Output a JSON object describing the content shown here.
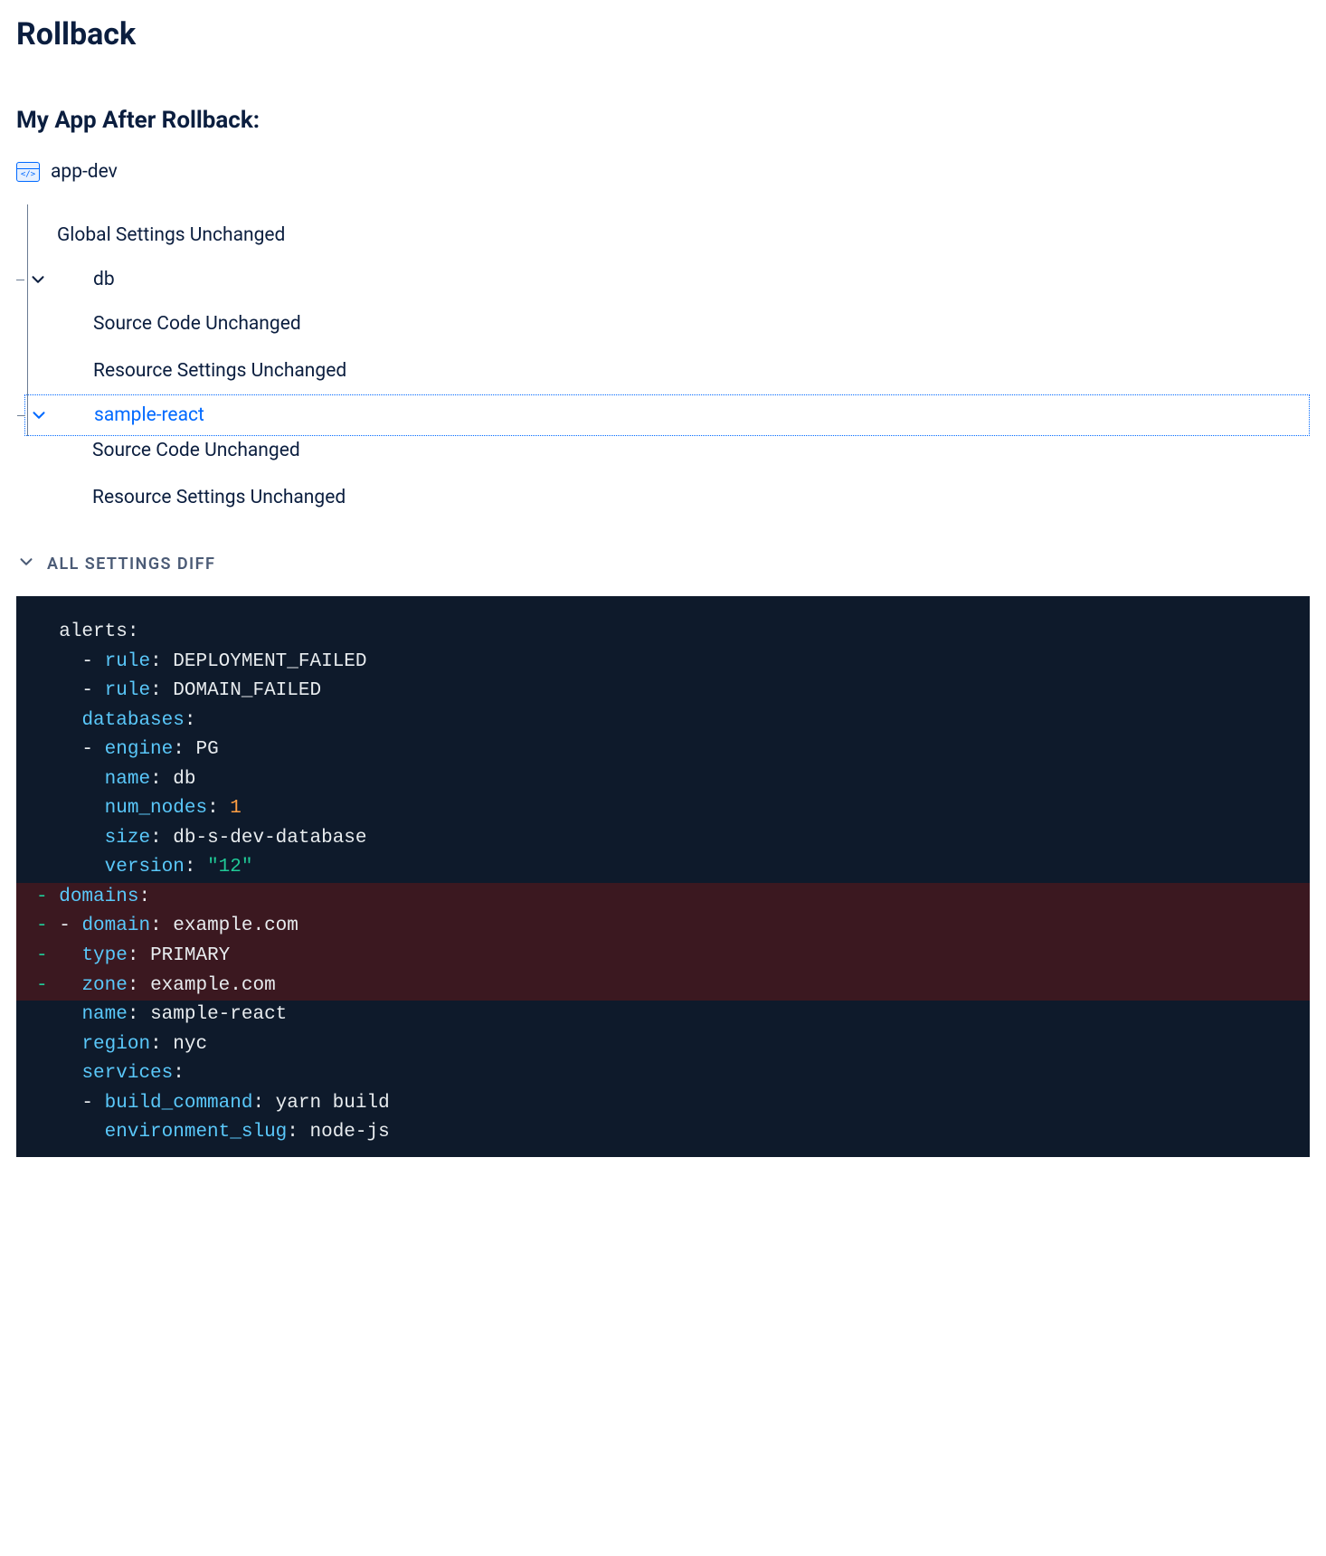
{
  "title": "Rollback",
  "subhead": "My App After Rollback:",
  "app": {
    "name": "app-dev"
  },
  "tree": {
    "global_unchanged": "Global Settings Unchanged",
    "nodes": [
      {
        "id": "db",
        "label": "db",
        "selected": false,
        "rows": [
          "Source Code Unchanged",
          "Resource Settings Unchanged"
        ]
      },
      {
        "id": "sample-react",
        "label": "sample-react",
        "selected": true,
        "rows": [
          "Source Code Unchanged",
          "Resource Settings Unchanged"
        ]
      }
    ]
  },
  "diff_section": {
    "label": "ALL SETTINGS DIFF"
  },
  "diff": [
    {
      "removed": false,
      "mark": "  ",
      "segs": [
        [
          "plain",
          "alerts:"
        ]
      ]
    },
    {
      "removed": false,
      "mark": "  ",
      "segs": [
        [
          "plain",
          "  - "
        ],
        [
          "kw",
          "rule"
        ],
        [
          "plain",
          ": DEPLOYMENT_FAILED"
        ]
      ]
    },
    {
      "removed": false,
      "mark": "  ",
      "segs": [
        [
          "plain",
          "  - "
        ],
        [
          "kw",
          "rule"
        ],
        [
          "plain",
          ": DOMAIN_FAILED"
        ]
      ]
    },
    {
      "removed": false,
      "mark": "  ",
      "segs": [
        [
          "plain",
          "  "
        ],
        [
          "kw",
          "databases"
        ],
        [
          "plain",
          ":"
        ]
      ]
    },
    {
      "removed": false,
      "mark": "  ",
      "segs": [
        [
          "plain",
          "  - "
        ],
        [
          "kw",
          "engine"
        ],
        [
          "plain",
          ": PG"
        ]
      ]
    },
    {
      "removed": false,
      "mark": "  ",
      "segs": [
        [
          "plain",
          "    "
        ],
        [
          "kw",
          "name"
        ],
        [
          "plain",
          ": db"
        ]
      ]
    },
    {
      "removed": false,
      "mark": "  ",
      "segs": [
        [
          "plain",
          "    "
        ],
        [
          "kw",
          "num_nodes"
        ],
        [
          "plain",
          ": "
        ],
        [
          "num",
          "1"
        ]
      ]
    },
    {
      "removed": false,
      "mark": "  ",
      "segs": [
        [
          "plain",
          "    "
        ],
        [
          "kw",
          "size"
        ],
        [
          "plain",
          ": db-s-dev-database"
        ]
      ]
    },
    {
      "removed": false,
      "mark": "  ",
      "segs": [
        [
          "plain",
          "    "
        ],
        [
          "kw",
          "version"
        ],
        [
          "plain",
          ": "
        ],
        [
          "str",
          "\"12\""
        ]
      ]
    },
    {
      "removed": true,
      "mark": "- ",
      "segs": [
        [
          "kw",
          "domains"
        ],
        [
          "plain",
          ":"
        ]
      ]
    },
    {
      "removed": true,
      "mark": "- ",
      "segs": [
        [
          "plain",
          "- "
        ],
        [
          "kw",
          "domain"
        ],
        [
          "plain",
          ": example.com"
        ]
      ]
    },
    {
      "removed": true,
      "mark": "- ",
      "segs": [
        [
          "plain",
          "  "
        ],
        [
          "kw",
          "type"
        ],
        [
          "plain",
          ": PRIMARY"
        ]
      ]
    },
    {
      "removed": true,
      "mark": "- ",
      "segs": [
        [
          "plain",
          "  "
        ],
        [
          "kw",
          "zone"
        ],
        [
          "plain",
          ": example.com"
        ]
      ]
    },
    {
      "removed": false,
      "mark": "  ",
      "segs": [
        [
          "plain",
          "  "
        ],
        [
          "kw",
          "name"
        ],
        [
          "plain",
          ": sample-react"
        ]
      ]
    },
    {
      "removed": false,
      "mark": "  ",
      "segs": [
        [
          "plain",
          "  "
        ],
        [
          "kw",
          "region"
        ],
        [
          "plain",
          ": nyc"
        ]
      ]
    },
    {
      "removed": false,
      "mark": "  ",
      "segs": [
        [
          "plain",
          "  "
        ],
        [
          "kw",
          "services"
        ],
        [
          "plain",
          ":"
        ]
      ]
    },
    {
      "removed": false,
      "mark": "  ",
      "segs": [
        [
          "plain",
          "  - "
        ],
        [
          "kw",
          "build_command"
        ],
        [
          "plain",
          ": yarn build"
        ]
      ]
    },
    {
      "removed": false,
      "mark": "  ",
      "segs": [
        [
          "plain",
          "    "
        ],
        [
          "kw",
          "environment_slug"
        ],
        [
          "plain",
          ": node-js"
        ]
      ]
    }
  ]
}
